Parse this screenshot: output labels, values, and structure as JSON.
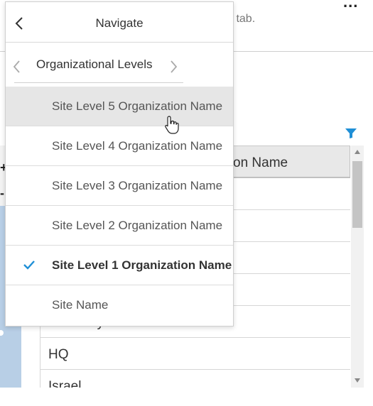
{
  "background": {
    "more_label": "...",
    "hint_text": "s tab.",
    "grid": {
      "header": "on Name",
      "rows": [
        "",
        "",
        "",
        "",
        "Germany",
        "HQ",
        "Israel"
      ]
    },
    "left_controls": [
      "+",
      "-"
    ]
  },
  "navigate": {
    "title": "Navigate",
    "level_label": "Organizational Levels",
    "items": [
      {
        "label": "Site Level 5 Organization Name",
        "state": "hovered"
      },
      {
        "label": "Site Level 4 Organization Name",
        "state": "normal"
      },
      {
        "label": "Site Level 3 Organization Name",
        "state": "normal"
      },
      {
        "label": "Site Level 2 Organization Name",
        "state": "normal"
      },
      {
        "label": "Site Level 1 Organization Name",
        "state": "selected"
      },
      {
        "label": "Site Name",
        "state": "normal"
      }
    ]
  },
  "colors": {
    "accent": "#1f8fd6",
    "hover": "#e6e6e6"
  }
}
